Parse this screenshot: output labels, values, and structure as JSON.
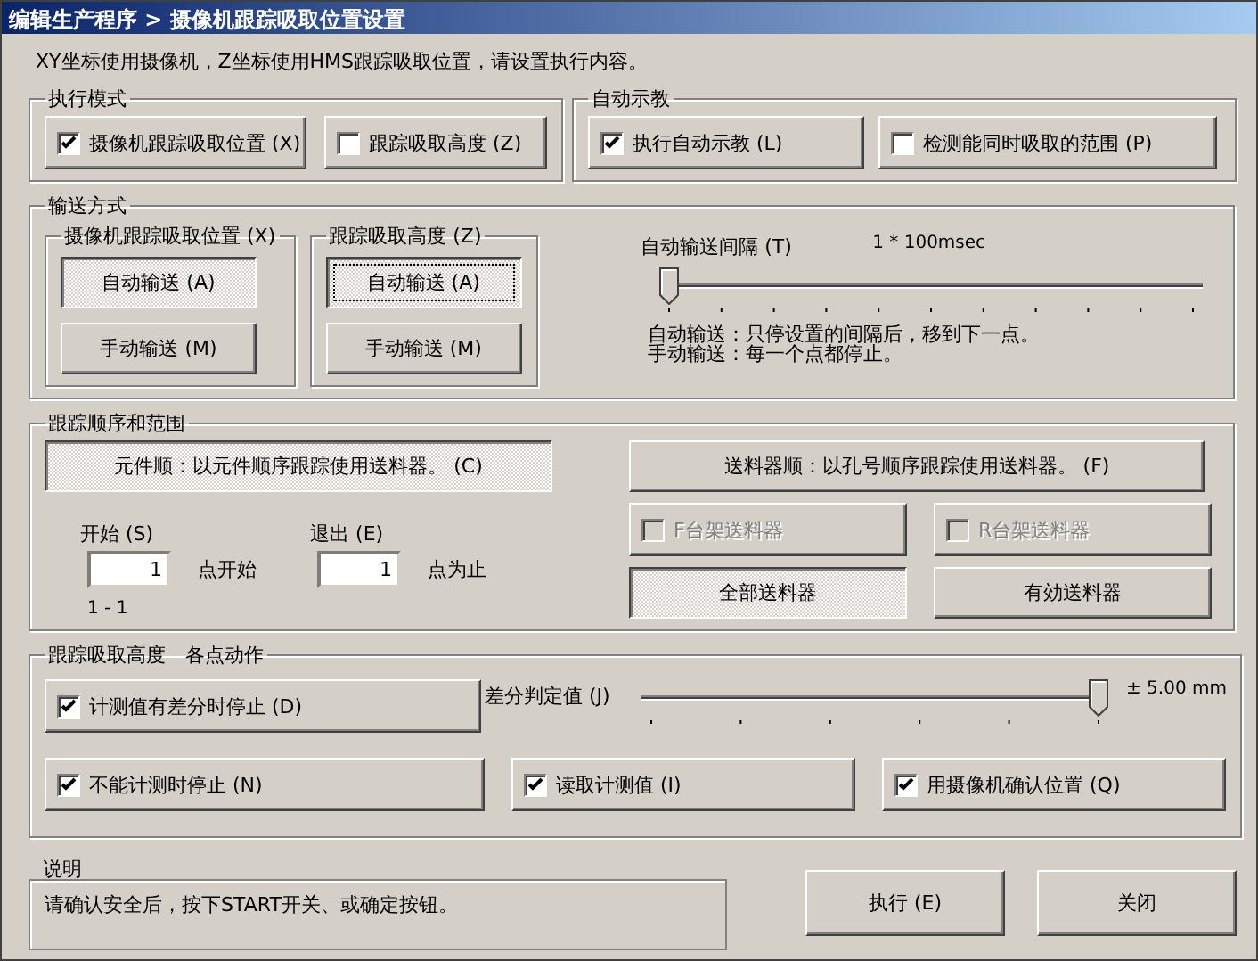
{
  "window": {
    "title": "编辑生产程序 > 摄像机跟踪吸取位置设置"
  },
  "instruction": "XY坐标使用摄像机，Z坐标使用HMS跟踪吸取位置，请设置执行内容。",
  "execution_mode": {
    "label": "执行模式",
    "options": [
      {
        "label": "摄像机跟踪吸取位置 (X)",
        "checked": true
      },
      {
        "label": "跟踪吸取高度 (Z)",
        "checked": false
      }
    ]
  },
  "auto_teach": {
    "label": "自动示教",
    "options": [
      {
        "label": "执行自动示教 (L)",
        "checked": true
      },
      {
        "label": "检测能同时吸取的范围 (P)",
        "checked": false
      }
    ]
  },
  "transfer": {
    "label": "输送方式",
    "groups": [
      {
        "label": "摄像机跟踪吸取位置 (X)",
        "buttons": [
          {
            "label": "自动输送 (A)",
            "selected": true,
            "focused": false
          },
          {
            "label": "手动输送 (M)",
            "selected": false,
            "focused": false
          }
        ]
      },
      {
        "label": "跟踪吸取高度 (Z)",
        "buttons": [
          {
            "label": "自动输送 (A)",
            "selected": true,
            "focused": true
          },
          {
            "label": "手动输送 (M)",
            "selected": false,
            "focused": false
          }
        ]
      }
    ],
    "interval": {
      "label": "自动输送间隔 (T)",
      "reading": "1 * 100msec",
      "level": 0
    },
    "notes": [
      "自动输送：只停设置的间隔后，移到下一点。",
      "手动输送：每一个点都停止。"
    ]
  },
  "order": {
    "label": "跟踪顺序和范围",
    "modes": [
      {
        "label": "元件顺：以元件顺序跟踪使用送料器。 (C)",
        "selected": true
      },
      {
        "label": "送料器顺：以孔号顺序跟踪使用送料器。 (F)",
        "selected": false
      }
    ],
    "tables": [
      {
        "label": "F台架送料器",
        "checked": false,
        "disabled": true
      },
      {
        "label": "R台架送料器",
        "checked": false,
        "disabled": true
      }
    ],
    "start": {
      "label": "开始 (S)",
      "value": "1",
      "suffix": "点开始"
    },
    "end": {
      "label": "退出 (E)",
      "value": "1",
      "suffix": "点为止"
    },
    "range": "1 - 1",
    "feeders": [
      {
        "label": "全部送料器",
        "selected": true
      },
      {
        "label": "有効送料器",
        "selected": false
      }
    ]
  },
  "height": {
    "label": "跟踪吸取高度　各点动作",
    "options": [
      {
        "label": "计测值有差分时停止 (D)",
        "checked": true
      },
      {
        "label": "不能计测时停止 (N)",
        "checked": true
      },
      {
        "label": "读取计测值 (I)",
        "checked": true
      },
      {
        "label": "用摄像机确认位置 (Q)",
        "checked": true
      }
    ],
    "threshold": {
      "label": "差分判定值 (J)",
      "reading": "± 5.00 mm",
      "level": 1
    }
  },
  "description": {
    "label": "说明",
    "text": "请确认安全后，按下START开关、或确定按钮。"
  },
  "buttons": [
    {
      "label": "执行 (E)"
    },
    {
      "label": "关闭"
    }
  ]
}
